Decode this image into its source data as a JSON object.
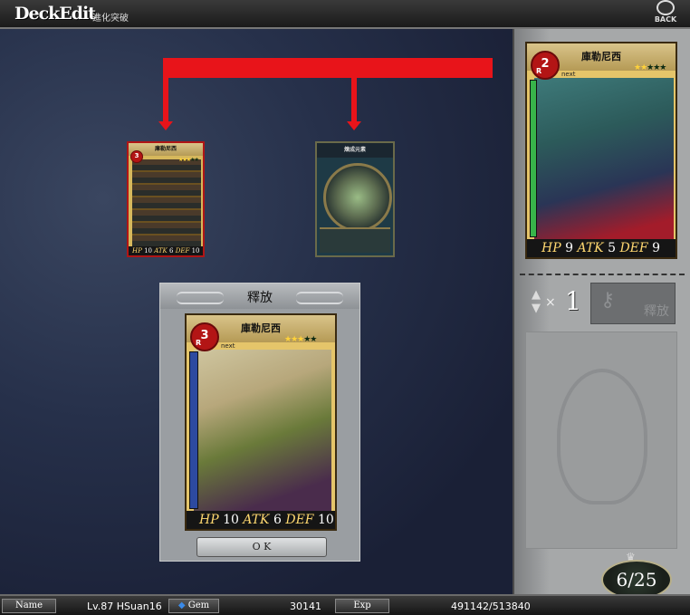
{
  "header": {
    "title": "DeckEdit",
    "subtitle": "進化突破",
    "back_label": "BACK"
  },
  "connector_color": "#e8141a",
  "selected_card": {
    "name": "庫勒尼西",
    "rarity_letter": "R",
    "level": "3",
    "stars_lit": "★★★",
    "stars_dim": "★★",
    "hp_label": "HP",
    "hp": "10",
    "atk_label": "ATK",
    "atk": "6",
    "def_label": "DEF",
    "def": "10"
  },
  "material_card": {
    "name": "煉成元素"
  },
  "release_panel": {
    "title": "釋放",
    "card": {
      "name": "庫勒尼西",
      "rarity_letter": "R",
      "level": "3",
      "next_label": "next",
      "stars_lit": "★★★",
      "stars_dim": "★★",
      "hp_label": "HP",
      "hp": "10",
      "atk_label": "ATK",
      "atk": "6",
      "def_label": "DEF",
      "def": "10"
    },
    "ok_label": "O K"
  },
  "preview_card": {
    "name": "庫勒尼西",
    "rarity_letter": "R",
    "level": "2",
    "next_label": "next",
    "stars_lit": "★★",
    "stars_dim": "★★★",
    "hp_label": "HP",
    "hp": "9",
    "atk_label": "ATK",
    "atk": "5",
    "def_label": "DEF",
    "def": "9"
  },
  "release_controls": {
    "times": "×",
    "count": "1",
    "button_label": "釋放"
  },
  "deck_count": "6/25",
  "footer": {
    "name_label": "Name",
    "name_value": "Lv.87 HSuan16",
    "gem_label": "Gem",
    "gem_value": "30141",
    "exp_label": "Exp",
    "exp_value": "491142/513840"
  }
}
